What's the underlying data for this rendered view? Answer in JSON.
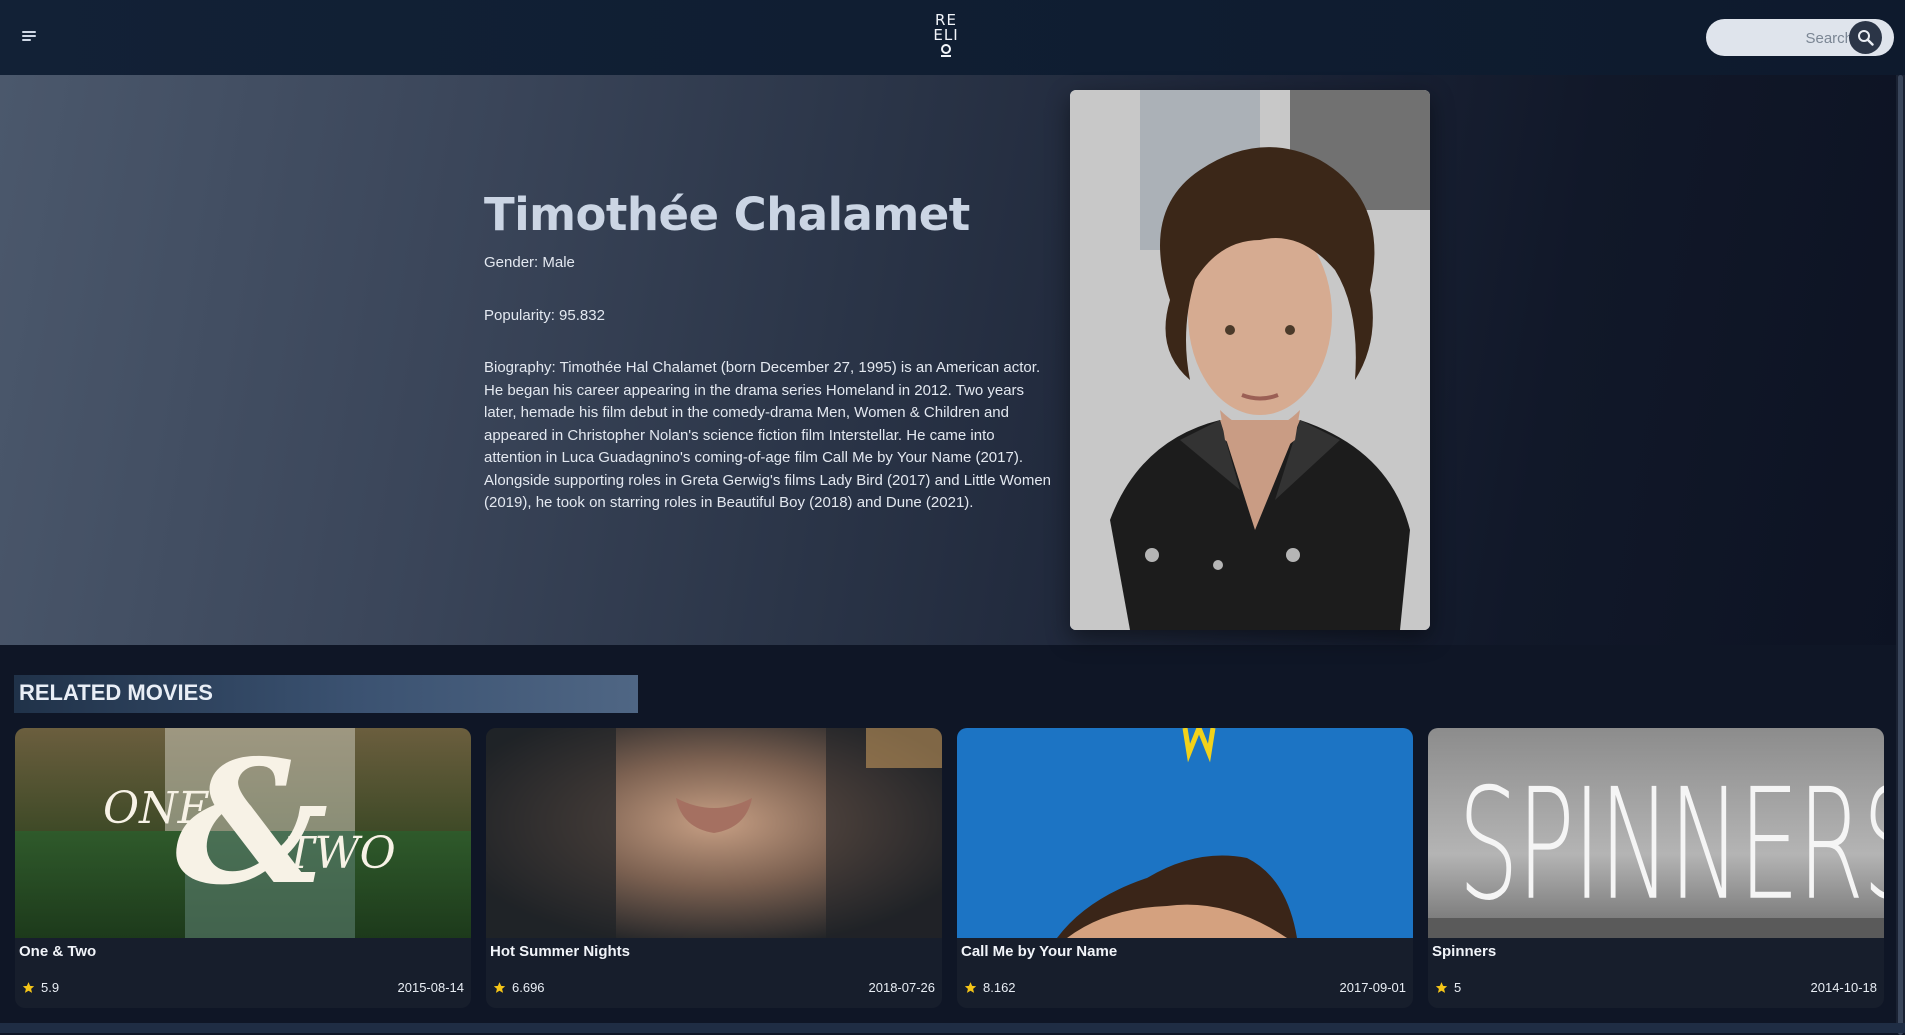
{
  "header": {
    "logo_text": [
      "RE",
      "ELI"
    ],
    "search_placeholder": "Search",
    "icons": {
      "menu": "hamburger-menu-icon",
      "search": "search-icon"
    }
  },
  "person": {
    "name": "Timothée Chalamet",
    "gender": "Gender: Male",
    "popularity": "Popularity: 95.832",
    "biography": "Biography: Timothée Hal Chalamet (born December 27, 1995) is an American actor. He began his career appearing in the drama series Homeland in 2012. Two years later, hemade his film debut in the comedy-drama Men, Women & Children and appeared in Christopher Nolan's science fiction film Interstellar. He came into attention in Luca Guadagnino's coming-of-age film Call Me by Your Name (2017). Alongside supporting roles in Greta Gerwig's films Lady Bird (2017) and Little Women (2019), he took on starring roles in Beautiful Boy (2018) and Dune (2021)."
  },
  "related": {
    "heading": "RELATED MOVIES",
    "movies": [
      {
        "title": "One & Two",
        "rating": "5.9",
        "date": "2015-08-14",
        "poster_text": [
          "ONE",
          "&",
          "TWO"
        ]
      },
      {
        "title": "Hot Summer Nights",
        "rating": "6.696",
        "date": "2018-07-26"
      },
      {
        "title": "Call Me by Your Name",
        "rating": "8.162",
        "date": "2017-09-01"
      },
      {
        "title": "Spinners",
        "rating": "5",
        "date": "2014-10-18",
        "poster_text": "SPINNERS"
      }
    ]
  },
  "colors": {
    "star": "#f5c518",
    "accent": "#4f6684"
  }
}
